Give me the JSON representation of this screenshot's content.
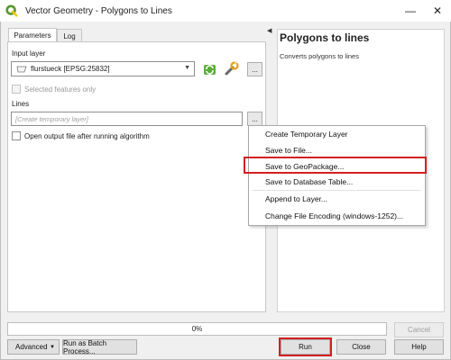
{
  "window": {
    "title": "Vector Geometry - Polygons to Lines",
    "minimize": "—",
    "close": "✕"
  },
  "tabs": [
    {
      "label": "Parameters",
      "active": true
    },
    {
      "label": "Log",
      "active": false
    }
  ],
  "parameters": {
    "input_layer_label": "Input layer",
    "input_layer_value": "flurstueck [EPSG:25832]",
    "selected_features_label": "Selected features only",
    "lines_label": "Lines",
    "lines_placeholder": "[Create temporary layer]",
    "open_output_label": "Open output file after running algorithm",
    "dots": "..."
  },
  "help": {
    "title": "Polygons to lines",
    "description": "Converts polygons to lines"
  },
  "menu": {
    "items": [
      "Create Temporary Layer",
      "Save to File...",
      "Save to GeoPackage...",
      "Save to Database Table...",
      "Append to Layer...",
      "Change File Encoding (windows-1252)..."
    ],
    "highlighted": "Save to GeoPackage..."
  },
  "progress": {
    "text": "0%",
    "value": 0
  },
  "buttons": {
    "cancel": "Cancel",
    "advanced": "Advanced",
    "batch": "Run as Batch Process...",
    "run": "Run",
    "close": "Close",
    "help": "Help"
  },
  "colors": {
    "highlight": "#d32020",
    "qgis_green": "#589632",
    "qgis_yellow": "#eec90d"
  }
}
